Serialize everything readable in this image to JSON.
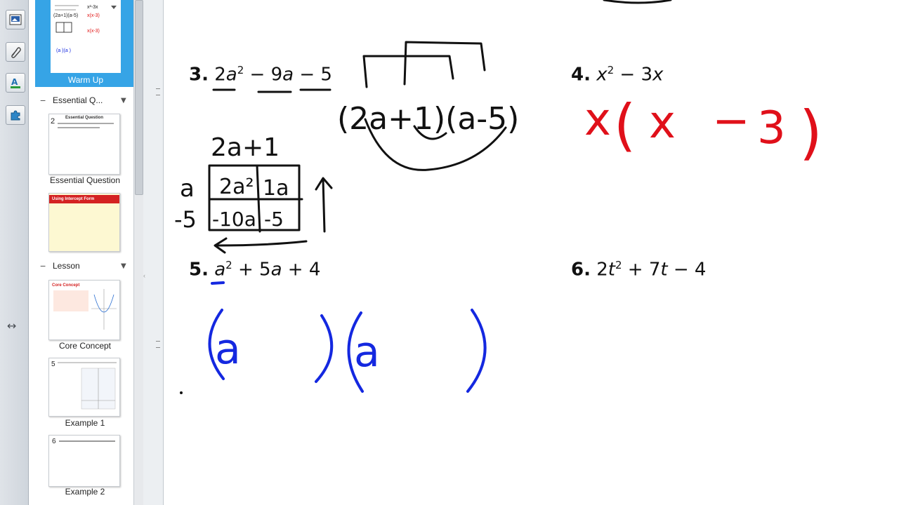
{
  "tools": [
    {
      "name": "gallery-icon"
    },
    {
      "name": "attachments-icon"
    },
    {
      "name": "properties-icon"
    },
    {
      "name": "addons-icon"
    }
  ],
  "sorter": {
    "slides": {
      "warmup": {
        "label": "Warm Up"
      },
      "eq": {
        "label": "Essential Question",
        "thumb_title": "Essential Question",
        "thumb_num": "2"
      },
      "intercept": {
        "thumb_title": "Using Intercept Form"
      },
      "core": {
        "label": "Core Concept",
        "thumb_title": "Core Concept"
      },
      "ex1": {
        "label": "Example 1",
        "thumb_num": "5"
      },
      "ex2": {
        "label": "Example 2",
        "thumb_num": "6"
      }
    },
    "groups": {
      "essential": {
        "label": "Essential Q..."
      },
      "lesson": {
        "label": "Lesson"
      }
    }
  },
  "problems": {
    "p3": {
      "num": "3.",
      "coef": "2",
      "v1": "a",
      "exp": "2",
      "mid": " − 9",
      "v2": "a",
      "end": " − 5"
    },
    "p4": {
      "num": "4.",
      "v1": "x",
      "exp": "2",
      "mid": " − 3",
      "v2": "x"
    },
    "p5": {
      "num": "5.",
      "v1": "a",
      "exp": "2",
      "mid": " + 5",
      "v2": "a",
      "end": " + 4"
    },
    "p6": {
      "num": "6.",
      "coef": "2",
      "v1": "t",
      "exp": "2",
      "mid": " + 7",
      "v2": "t",
      "end": " − 4"
    }
  },
  "ink": {
    "p3_factored": "(2a+1)(a-5)",
    "box_top": "2a+1",
    "box_left_top": "a",
    "box_left_bottom": "-5",
    "box_cells": [
      "2a²",
      "1a",
      "-10a",
      "-5"
    ],
    "p4_answer_x": "x",
    "p4_answer_open": "(",
    "p4_answer_inner_x": "x",
    "p4_answer_minus": "−",
    "p4_answer_three": "3",
    "p4_answer_close": ")",
    "p5_work_a1": "a",
    "p5_work_a2": "a",
    "colors": {
      "black": "#111111",
      "red": "#e0101a",
      "blue": "#1428e0"
    }
  }
}
